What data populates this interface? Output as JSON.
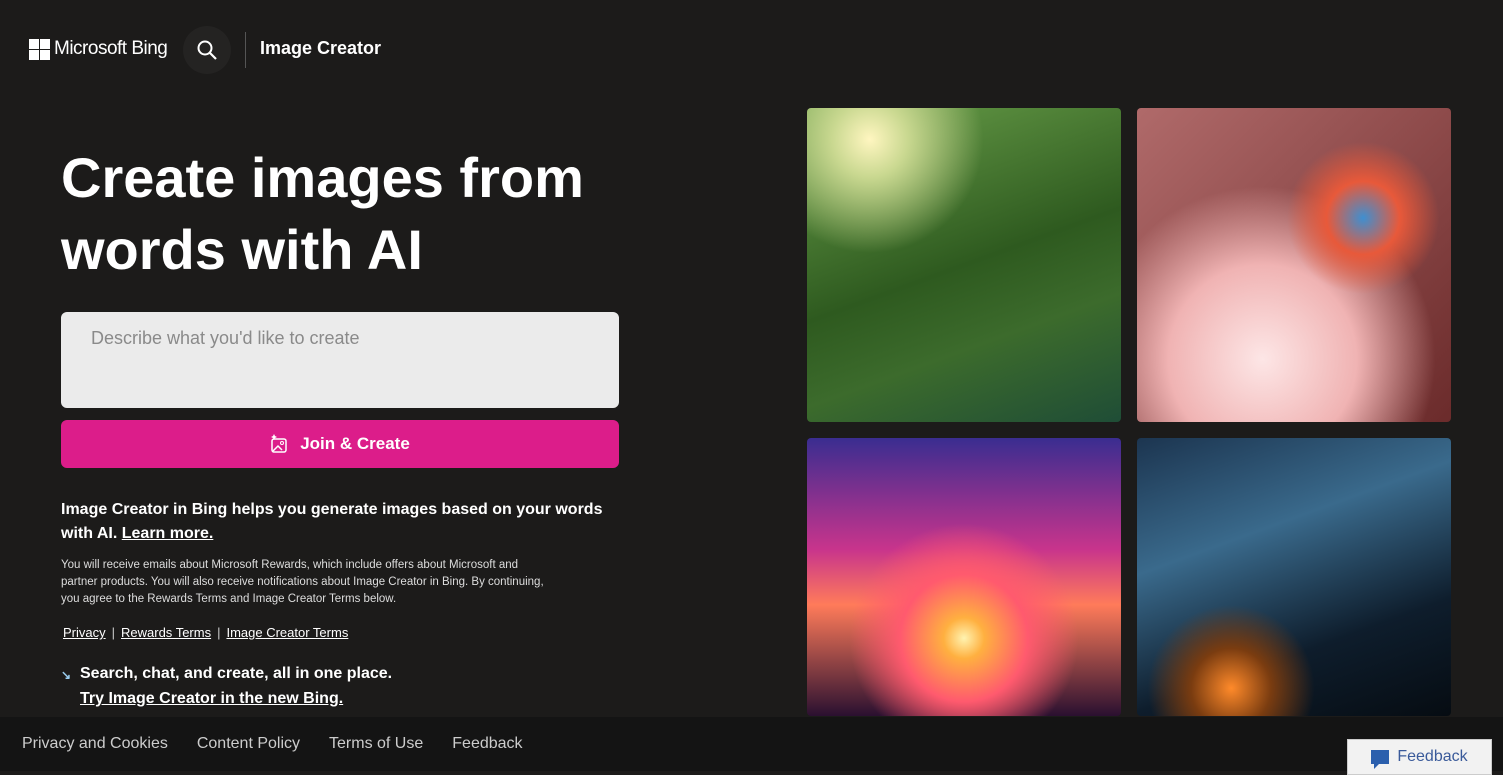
{
  "header": {
    "brand": "Microsoft Bing",
    "app_title": "Image Creator"
  },
  "hero": {
    "title": "Create images from words with AI"
  },
  "prompt": {
    "placeholder": "Describe what you'd like to create",
    "value": ""
  },
  "create_button": {
    "label": "Join & Create"
  },
  "description": {
    "text": "Image Creator in Bing helps you generate images based on your words with AI.",
    "link": "Learn more."
  },
  "fine_print": "You will receive emails about Microsoft Rewards, which include offers about Microsoft and partner products. You will also receive notifications about Image Creator in Bing. By continuing, you agree to the Rewards Terms and Image Creator Terms below.",
  "legal_links": [
    "Privacy",
    "Rewards Terms",
    "Image Creator Terms"
  ],
  "separator": "|",
  "promo": {
    "text": "Search, chat, and create, all in one place.",
    "link": "Try Image Creator in the new Bing."
  },
  "footer": {
    "links": [
      "Privacy and Cookies",
      "Content Policy",
      "Terms of Use",
      "Feedback"
    ]
  },
  "feedback_button": {
    "label": "Feedback"
  },
  "colors": {
    "accent": "#dc1d8a",
    "background": "#1c1b1a"
  }
}
